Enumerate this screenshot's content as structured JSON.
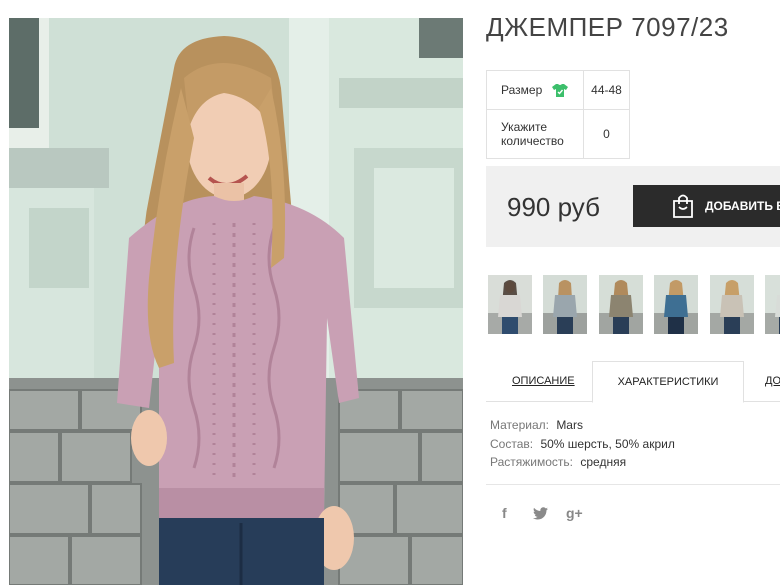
{
  "product": {
    "title": "ДЖЕМПЕР 7097/23",
    "options": {
      "size_label": "Размер",
      "size_value": "44-48",
      "qty_label": "Укажите количество",
      "qty_value": "0"
    },
    "price": "990 руб",
    "add_to_cart_label": "ДОБАВИТЬ В",
    "thumbnails": [
      {
        "sweater_color": "#d9d7d4"
      },
      {
        "sweater_color": "#9aa6ad"
      },
      {
        "sweater_color": "#8c8470"
      },
      {
        "sweater_color": "#3e6f93"
      },
      {
        "sweater_color": "#c9c2b6"
      },
      {
        "sweater_color": "#d8dcd8"
      }
    ]
  },
  "tabs": [
    {
      "label": "ОПИСАНИЕ"
    },
    {
      "label": "ХАРАКТЕРИСТИКИ"
    },
    {
      "label": "ДО"
    }
  ],
  "specs": [
    {
      "key": "Материал:",
      "value": "Mars"
    },
    {
      "key": "Состав:",
      "value": "50% шерсть, 50% акрил"
    },
    {
      "key": "Растяжимость:",
      "value": "средняя"
    }
  ],
  "social": {
    "facebook": "f",
    "twitter": "twitter-icon",
    "googleplus": "g+"
  },
  "colors": {
    "sweater": "#c9a0b4",
    "dark_button": "#2b2b2b",
    "price_bg": "#f0f0f0",
    "size_icon_green": "#3cbf6b"
  }
}
